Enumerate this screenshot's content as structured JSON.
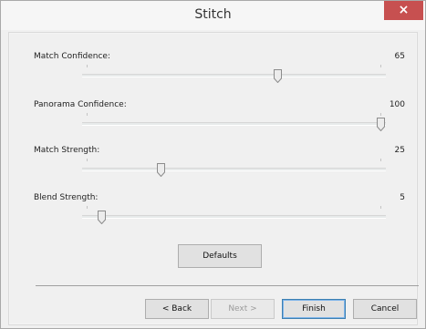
{
  "window": {
    "title": "Stitch",
    "close_glyph": "×"
  },
  "sliders": [
    {
      "label": "Match Confidence:",
      "value_text": "65",
      "fraction": 0.65
    },
    {
      "label": "Panorama Confidence:",
      "value_text": "100",
      "fraction": 1.0
    },
    {
      "label": "Match Strength:",
      "value_text": "25",
      "fraction": 0.25
    },
    {
      "label": "Blend Strength:",
      "value_text": "5",
      "fraction": 0.05
    }
  ],
  "buttons": {
    "defaults": "Defaults",
    "back": "< Back",
    "next": "Next >",
    "finish": "Finish",
    "cancel": "Cancel"
  },
  "colors": {
    "close_button": "#c75050",
    "focus_border": "#3c7fb1"
  }
}
